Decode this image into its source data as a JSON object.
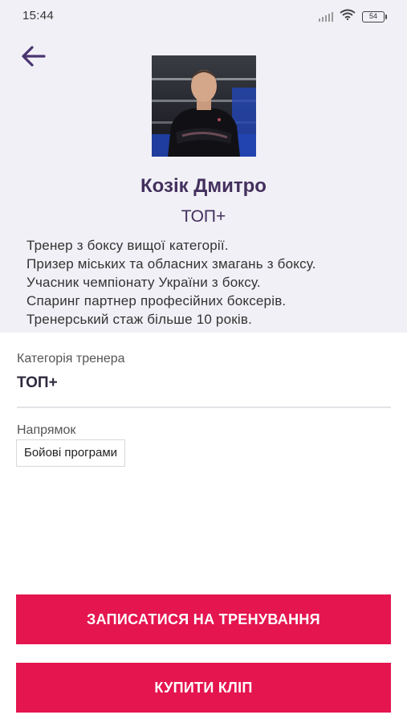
{
  "status_bar": {
    "time": "15:44",
    "battery": "54"
  },
  "trainer": {
    "name": "Козік Дмитро",
    "level": "ТОП+",
    "bio": [
      "Тренер з боксу вищої категорії.",
      "Призер міських та обласних змагань з боксу.",
      "Учасник чемпіонату України з боксу.",
      "Спаринг партнер професійних боксерів.",
      "Тренерський стаж більше 10 років."
    ]
  },
  "details": {
    "category_label": "Категорія тренера",
    "category_value": "ТОП+",
    "direction_label": "Напрямок",
    "direction_tags": [
      "Бойові програми"
    ]
  },
  "actions": {
    "signup_label": "ЗАПИСАТИСЯ НА ТРЕНУВАННЯ",
    "buy_label": "КУПИТИ КЛІП"
  },
  "colors": {
    "accent": "#e5154f",
    "header_bg": "#f1f0f6",
    "title": "#43305e"
  }
}
